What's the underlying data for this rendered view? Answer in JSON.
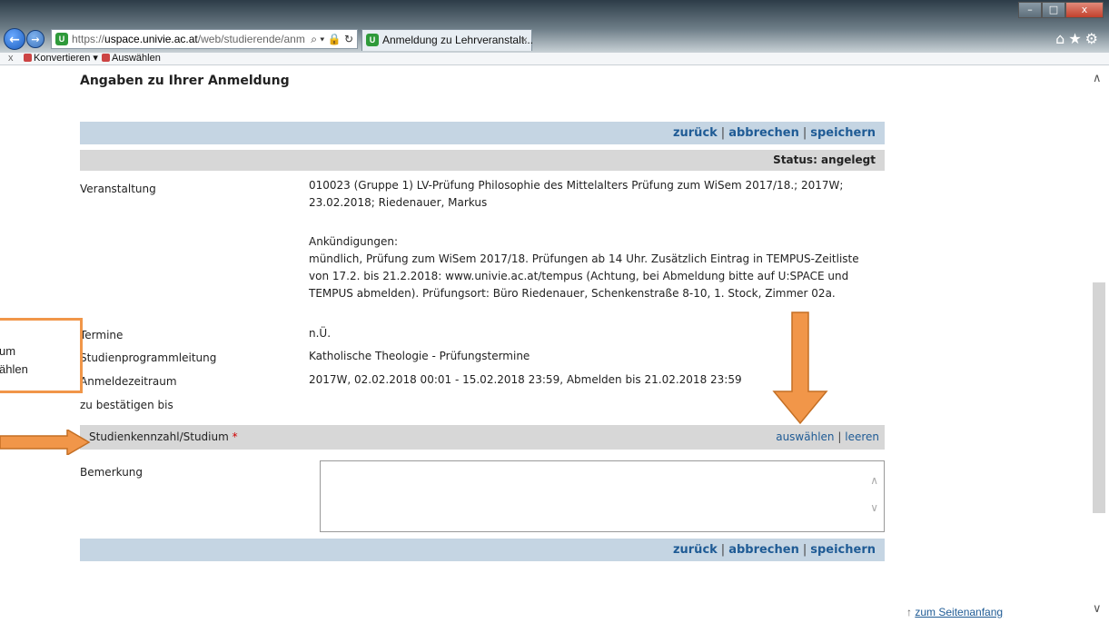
{
  "browser": {
    "url_prefix": "https://",
    "url_host": "uspace.univie.ac.at",
    "url_path": "/web/studierende/anm",
    "addr_tools": "⌕ ▾ 🔒 ↻",
    "tab_title": "Anmeldung zu Lehrveranstalt...",
    "tab_close": "×",
    "favicon_letter": "U",
    "toolbar_icons": "⌂★⚙",
    "minimize": "–",
    "maximize": "□",
    "close": "x"
  },
  "commandbar": {
    "close": "x",
    "convert": "Konvertieren ▾",
    "select": "Auswählen"
  },
  "page": {
    "heading": "Angaben zu Ihrer Anmeldung",
    "actions": {
      "back": "zurück",
      "cancel": "abbrechen",
      "save": "speichern",
      "separator": "|"
    },
    "status": "Status: angelegt",
    "fields": {
      "veranstaltung_label": "Veranstaltung",
      "veranstaltung_value": "010023 (Gruppe 1) LV-Prüfung Philosophie des Mittelalters Prüfung zum WiSem 2017/18.; 2017W; 23.02.2018; Riedenauer, Markus",
      "ankuendigungen_title": "Ankündigungen:",
      "ankuendigungen_text": "mündlich, Prüfung zum WiSem 2017/18. Prüfungen ab 14 Uhr. Zusätzlich Eintrag in TEMPUS-Zeitliste von 17.2. bis 21.2.2018: www.univie.ac.at/tempus (Achtung, bei Abmeldung bitte auf U:SPACE und TEMPUS abmelden). Prüfungsort: Büro Riedenauer, Schenkenstraße 8-10, 1. Stock, Zimmer 02a.",
      "termine_label": "Termine",
      "termine_value": "n.Ü.",
      "studienprogramm_label": "Studienprogrammleitung",
      "studienprogramm_value": "Katholische Theologie - Prüfungstermine",
      "anmeldezeitraum_label": "Anmeldezeitraum",
      "anmeldezeitraum_value": "2017W, 02.02.2018 00:01 - 15.02.2018 23:59, Abmelden bis 21.02.2018 23:59",
      "bestaetigen_label": "zu bestätigen bis",
      "studium_label": "Studienkennzahl/Studium",
      "required_mark": "*",
      "select_action": "auswählen",
      "clear_action": "leeren",
      "bemerkung_label": "Bemerkung"
    },
    "top_link_arrow": "↑",
    "top_link": "zum Seitenanfang"
  },
  "annotation": {
    "line1": "um",
    "line2": "ählen",
    "color": "#f19649"
  },
  "scrollbar": {
    "up": "∧",
    "down": "∨"
  }
}
